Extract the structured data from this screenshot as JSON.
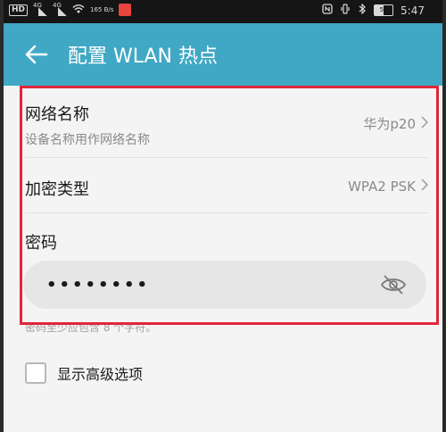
{
  "status_bar": {
    "hd": "HD",
    "signal1_tag": "4G",
    "signal2_tag": "4G",
    "speed": "165 B/s",
    "time": "5:47",
    "battery": "50"
  },
  "app_bar": {
    "title": "配置 WLAN 热点"
  },
  "network_name": {
    "title": "网络名称",
    "subtitle": "设备名称用作网络名称",
    "value": "华为p20"
  },
  "encryption": {
    "title": "加密类型",
    "value": "WPA2 PSK"
  },
  "password": {
    "title": "密码",
    "value": "••••••••",
    "hint": "密码至少应包含 8 个字符。"
  },
  "advanced": {
    "label": "显示高级选项"
  },
  "colors": {
    "accent": "#40a8c4",
    "annotation": "#e0263a"
  }
}
